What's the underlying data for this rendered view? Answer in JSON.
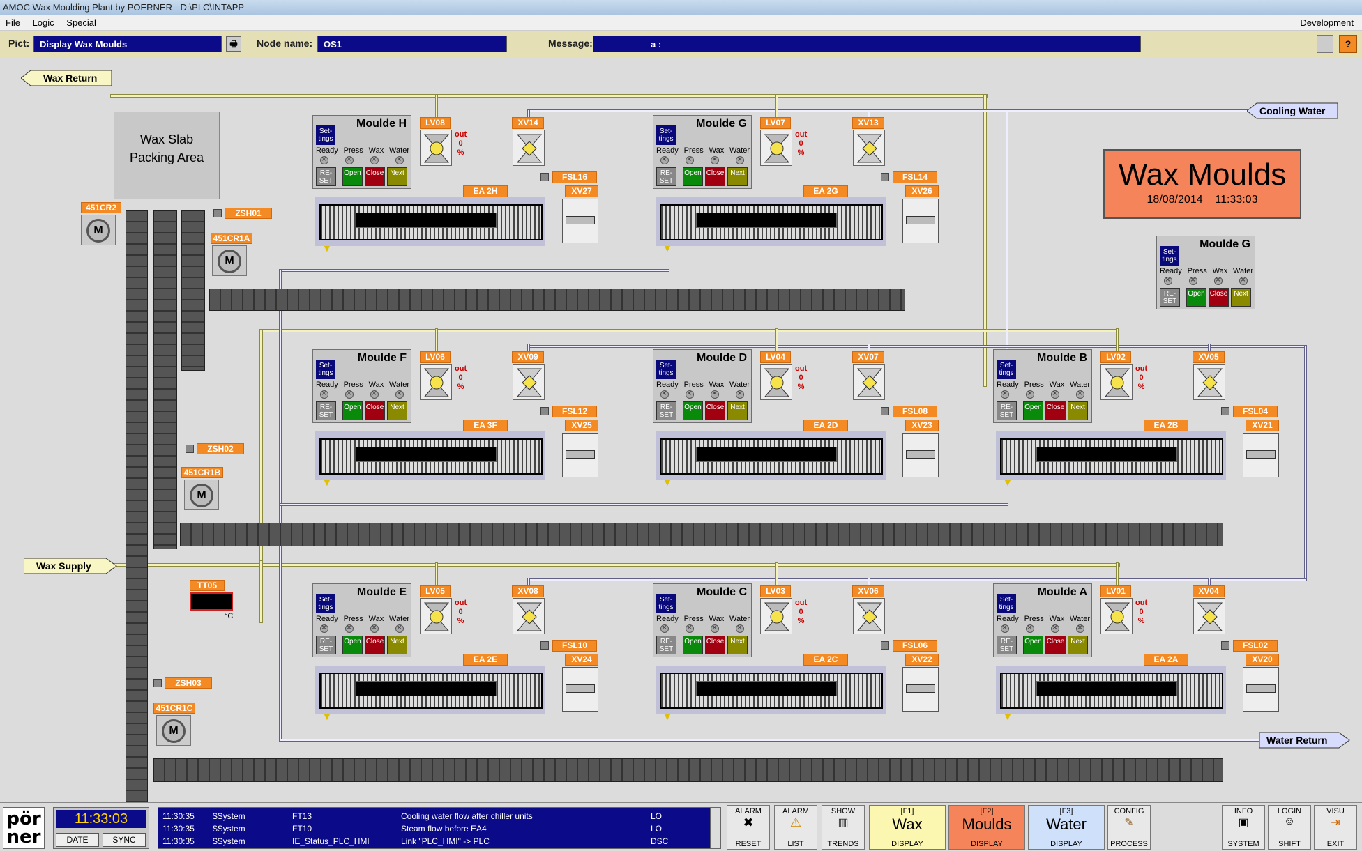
{
  "window": {
    "title": "AMOC Wax Moulding Plant by POERNER - D:\\PLC\\INTAPP"
  },
  "menu": {
    "file": "File",
    "logic": "Logic",
    "special": "Special",
    "right": "Development"
  },
  "infobar": {
    "pict_label": "Pict:",
    "pict_value": "Display Wax Moulds",
    "node_label": "Node name:",
    "node_value": "OS1",
    "message_label": "Message:",
    "message_value": "a :",
    "help": "?"
  },
  "header": {
    "title": "Wax Moulds",
    "date": "18/08/2014",
    "time": "11:33:03"
  },
  "pipes": {
    "wax_return": "Wax Return",
    "wax_supply": "Wax Supply",
    "cooling_water": "Cooling Water",
    "water_return": "Water Return"
  },
  "area": {
    "packing": "Wax Slab Packing Area"
  },
  "mould_ui": {
    "settings": "Set- tings",
    "ready": "Ready",
    "press": "Press",
    "wax": "Wax",
    "water": "Water",
    "reset": "RE- SET",
    "open": "Open",
    "close": "Close",
    "next": "Next",
    "out": "out",
    "zero": "0",
    "pct": "%"
  },
  "moulds": [
    {
      "name": "Moulde H",
      "lv": "LV08",
      "xv": "XV14",
      "fsl": "FSL16",
      "ea": "EA 2H",
      "xv2": "XV27"
    },
    {
      "name": "Moulde G",
      "lv": "LV07",
      "xv": "XV13",
      "fsl": "FSL14",
      "ea": "EA 2G",
      "xv2": "XV26"
    },
    {
      "name": "Moulde F",
      "lv": "LV06",
      "xv": "XV09",
      "fsl": "FSL12",
      "ea": "EA 3F",
      "xv2": "XV25"
    },
    {
      "name": "Moulde D",
      "lv": "LV04",
      "xv": "XV07",
      "fsl": "FSL08",
      "ea": "EA 2D",
      "xv2": "XV23"
    },
    {
      "name": "Moulde B",
      "lv": "LV02",
      "xv": "XV05",
      "fsl": "FSL04",
      "ea": "EA 2B",
      "xv2": "XV21"
    },
    {
      "name": "Moulde E",
      "lv": "LV05",
      "xv": "XV08",
      "fsl": "FSL10",
      "ea": "EA 2E",
      "xv2": "XV24"
    },
    {
      "name": "Moulde C",
      "lv": "LV03",
      "xv": "XV06",
      "fsl": "FSL06",
      "ea": "EA 2C",
      "xv2": "XV22"
    },
    {
      "name": "Moulde A",
      "lv": "LV01",
      "xv": "XV04",
      "fsl": "FSL02",
      "ea": "EA 2A",
      "xv2": "XV20"
    }
  ],
  "popup": {
    "name": "Moulde G"
  },
  "motors": {
    "m1": "451CR2",
    "m2": "451CR1A",
    "m3": "451CR1B",
    "m4": "451CR1C"
  },
  "sensors": {
    "s1": "ZSH01",
    "s2": "ZSH02",
    "s3": "ZSH03",
    "tt": "TT05",
    "unit": "°C"
  },
  "footer": {
    "logo": "pör ner",
    "clock": "11:33:03",
    "date_btn": "DATE",
    "sync_btn": "SYNC",
    "messages": [
      {
        "time": "11:30:35",
        "src": "$System",
        "tag": "FT13",
        "text": "Cooling water flow after chiller units",
        "lvl": "LO"
      },
      {
        "time": "11:30:35",
        "src": "$System",
        "tag": "FT10",
        "text": "Steam flow before EA4",
        "lvl": "LO"
      },
      {
        "time": "11:30:35",
        "src": "$System",
        "tag": "IE_Status_PLC_HMI",
        "text": "Link \"PLC_HMI\" -> PLC",
        "lvl": "DSC"
      }
    ],
    "alarm_reset_t": "ALARM",
    "alarm_reset_b": "RESET",
    "alarm_list_t": "ALARM",
    "alarm_list_b": "LIST",
    "trends_t": "SHOW",
    "trends_b": "TRENDS",
    "wax_f": "[F1]",
    "wax": "Wax",
    "wax_b": "DISPLAY",
    "moulds_f": "[F2]",
    "moulds": "Moulds",
    "moulds_b": "DISPLAY",
    "water_f": "[F3]",
    "water": "Water",
    "water_b": "DISPLAY",
    "config_t": "CONFIG",
    "config_b": "PROCESS",
    "info_t": "INFO",
    "info_b": "SYSTEM",
    "login_t": "LOGIN",
    "login_b": "SHIFT",
    "visu_t": "VISU",
    "visu_b": "EXIT"
  },
  "colors": {
    "tag_orange": "#f48a24",
    "title_bg": "#f6845a",
    "field_blue": "#0b0b8a",
    "wax_pipe": "#f4f2b8"
  }
}
